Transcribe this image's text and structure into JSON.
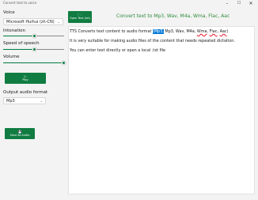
{
  "window": {
    "title": "Convert text to voice"
  },
  "voice": {
    "label": "Voice",
    "selected": "Microsoft Huihui (zh-CN)"
  },
  "intonation": {
    "label": "Intonation",
    "value": 0.5
  },
  "speed": {
    "label": "Speed of speech",
    "value": 0.5
  },
  "volume": {
    "label": "Volume",
    "value": 1.0
  },
  "play_button": {
    "label": "Play",
    "icon": "play-icon"
  },
  "output": {
    "label": "Output audio format",
    "selected": "Mp3"
  },
  "save_button": {
    "label": "Save as Audio",
    "icon": "save-icon"
  },
  "open_button": {
    "label": "Open Text (txt)",
    "icon": "folder-icon"
  },
  "header_text": "Convert text to Mp3, Wav, M4a, Wma, Flac, Aac",
  "editor": {
    "line1_a": "TTS Converts text content to audio format ",
    "line1_sel": "(Mp3,",
    "line1_b": " Mp3, Wav, M4a, ",
    "line1_wma": "Wma",
    "line1_c": ", ",
    "line1_flac": "Flac",
    "line1_d": ", ",
    "line1_aac": "Aac",
    "line1_e": ")",
    "line2": "It is very suitable for making audio files of the content that needs repeated dictation.",
    "line3": "You can enter text directly or open a local .txt file"
  },
  "colors": {
    "accent": "#107c41",
    "header_green": "#2e8b3a",
    "selection": "#0078d7"
  }
}
